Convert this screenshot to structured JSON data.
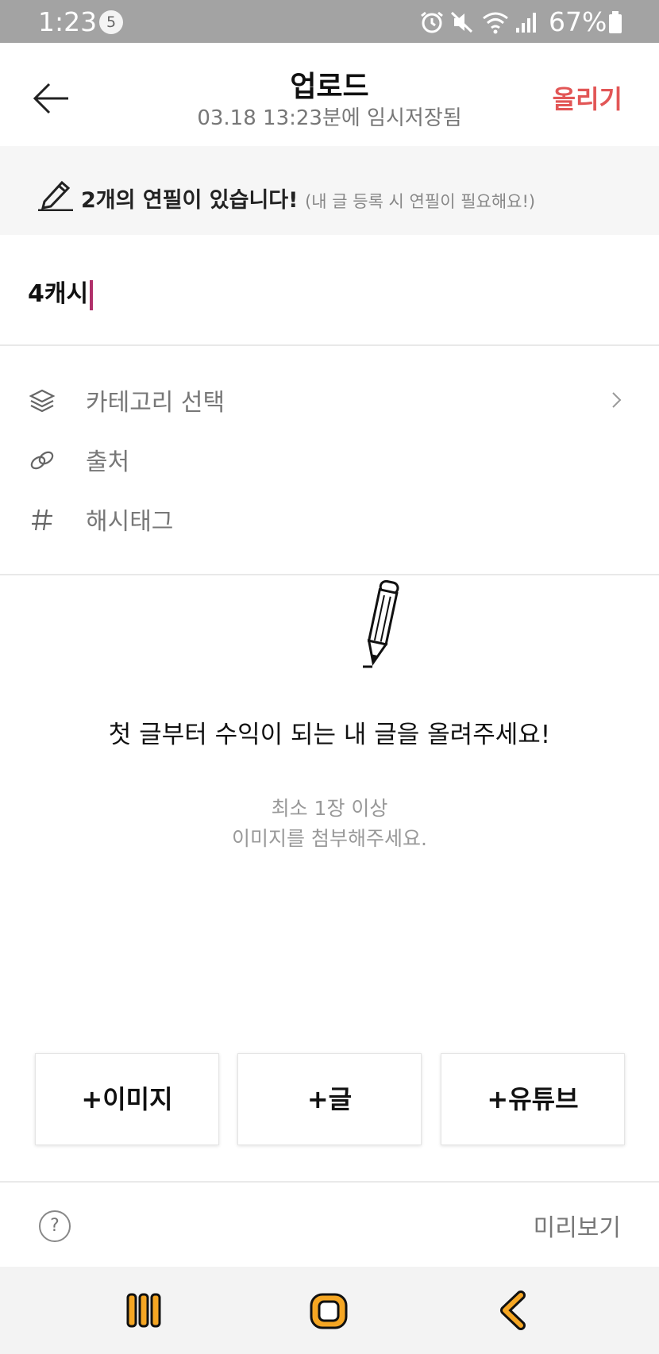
{
  "status_bar": {
    "time": "1:23",
    "notification_count": "5",
    "battery_percent": "67%"
  },
  "header": {
    "title": "업로드",
    "subtitle": "03.18 13:23분에 임시저장됨",
    "upload_label": "올리기"
  },
  "notice": {
    "bold_text": "2개의 연필이 있습니다!",
    "hint_text": "(내 글 등록 시 연필이 필요해요!)"
  },
  "title_input": {
    "value": "4캐시"
  },
  "options": [
    {
      "label": "카테고리 선택",
      "icon": "layers-icon"
    },
    {
      "label": "출처",
      "icon": "link-icon"
    },
    {
      "label": "해시태그",
      "icon": "hash-icon"
    }
  ],
  "empty_state": {
    "message": "첫 글부터 수익이 되는 내 글을 올려주세요!",
    "sub_line1": "최소 1장 이상",
    "sub_line2": "이미지를 첨부해주세요."
  },
  "add_buttons": [
    {
      "label": "+이미지"
    },
    {
      "label": "+글"
    },
    {
      "label": "+유튜브"
    }
  ],
  "footer": {
    "help_symbol": "?",
    "preview_label": "미리보기"
  },
  "colors": {
    "accent": "#e25656",
    "caret": "#b0306a",
    "nav_icon_fill": "#f5a623",
    "status_bar_bg": "#a3a3a3"
  }
}
